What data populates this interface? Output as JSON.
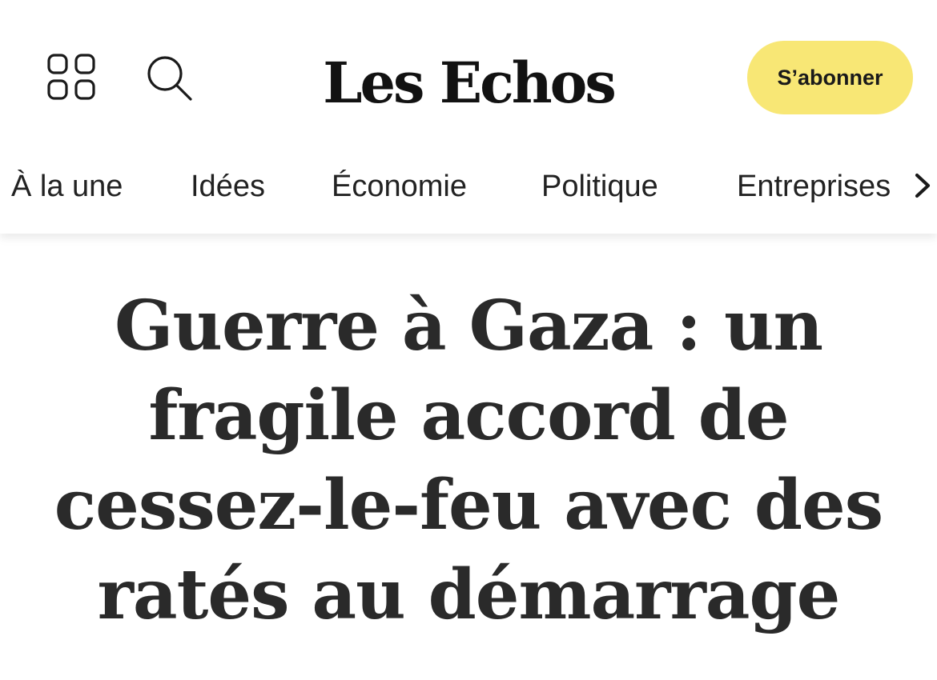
{
  "header": {
    "menu_icon": "grid-menu-icon",
    "search_icon": "search-icon",
    "logo_text": "Les Echos",
    "subscribe_label": "S’abonner",
    "subscribe_color": "#f8e775"
  },
  "nav": {
    "items": [
      {
        "label": "À la une"
      },
      {
        "label": "Idées"
      },
      {
        "label": "Économie"
      },
      {
        "label": "Politique"
      },
      {
        "label": "Entreprises"
      }
    ],
    "more_icon": "chevron-right-icon"
  },
  "article": {
    "headline": "Guerre à Gaza : un fragile accord de cessez-le-feu avec des ratés au démarrage"
  }
}
